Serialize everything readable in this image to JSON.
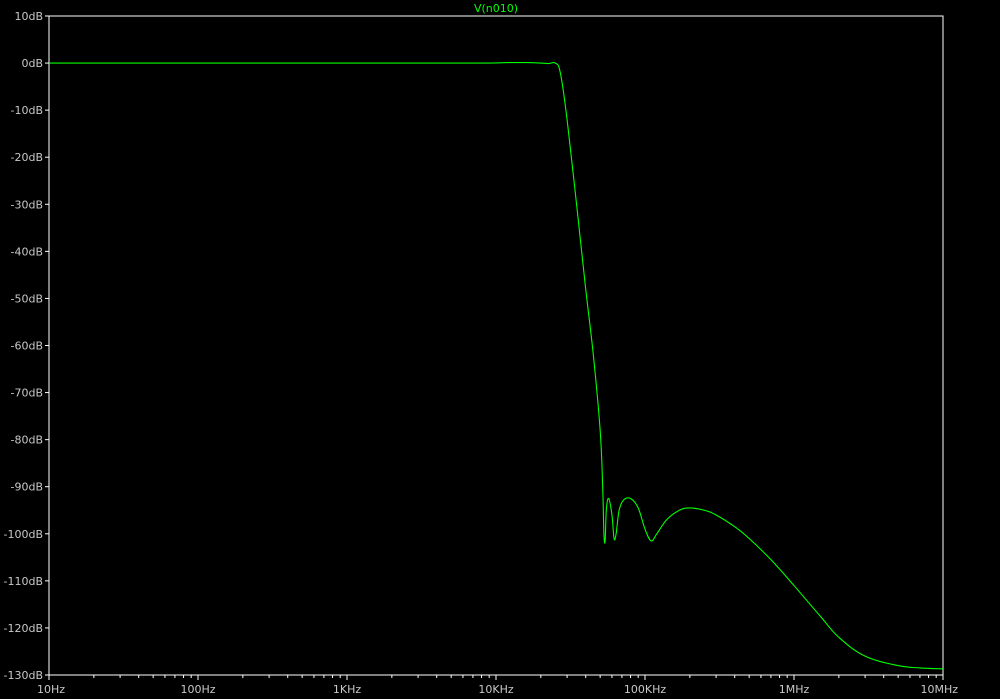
{
  "window": {
    "background": "#000000",
    "frame_color": "#ffffff",
    "text_color": "#c8c8c8"
  },
  "chart_data": {
    "type": "line",
    "title": "V(n010)",
    "xlabel": "",
    "ylabel": "",
    "xscale": "log",
    "xlim": [
      10,
      10000000
    ],
    "ylim": [
      -130,
      10
    ],
    "grid": false,
    "x_tick_labels": [
      "10Hz",
      "100Hz",
      "1KHz",
      "10KHz",
      "100KHz",
      "1MHz",
      "10MHz"
    ],
    "x_tick_values": [
      10,
      100,
      1000,
      10000,
      100000,
      1000000,
      10000000
    ],
    "y_tick_labels": [
      "10dB",
      "0dB",
      "-10dB",
      "-20dB",
      "-30dB",
      "-40dB",
      "-50dB",
      "-60dB",
      "-70dB",
      "-80dB",
      "-90dB",
      "-100dB",
      "-110dB",
      "-120dB",
      "-130dB"
    ],
    "y_tick_values": [
      10,
      0,
      -10,
      -20,
      -30,
      -40,
      -50,
      -60,
      -70,
      -80,
      -90,
      -100,
      -110,
      -120,
      -130
    ],
    "series": [
      {
        "color": "#00ff00",
        "x": [
          10,
          100,
          1000,
          3000,
          8000,
          12000,
          16000,
          20000,
          22500,
          25000,
          27000,
          30000,
          35000,
          40000,
          45000,
          50000,
          52000,
          53000,
          54000,
          55000,
          57000,
          60000,
          62000,
          64000,
          67000,
          72000,
          80000,
          90000,
          100000,
          110000,
          120000,
          140000,
          170000,
          200000,
          250000,
          300000,
          400000,
          500000,
          700000,
          1000000,
          1500000,
          2000000,
          3000000,
          5000000,
          7000000,
          10000000
        ],
        "y": [
          0,
          0,
          0,
          0,
          0,
          0.1,
          0.1,
          0,
          -0.1,
          0,
          -2,
          -12,
          -31,
          -48,
          -62,
          -78,
          -90,
          -100,
          -101.5,
          -95,
          -92.5,
          -96,
          -101,
          -100,
          -95,
          -92.8,
          -92.5,
          -94.5,
          -99,
          -101.5,
          -100,
          -97,
          -95,
          -94.5,
          -95,
          -96,
          -98.5,
          -101,
          -105.5,
          -111,
          -117.5,
          -122,
          -126,
          -128,
          -128.5,
          -128.7
        ]
      }
    ]
  }
}
